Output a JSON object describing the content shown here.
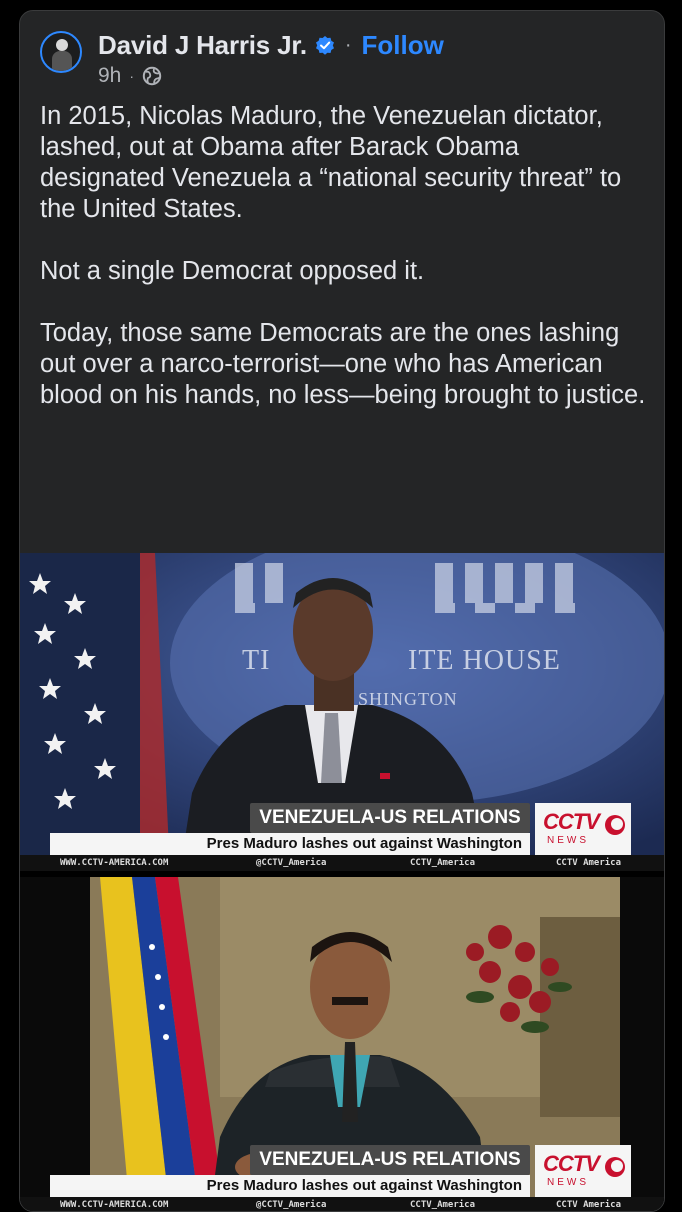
{
  "post": {
    "author": "David J Harris Jr.",
    "follow_label": "Follow",
    "separator": "·",
    "time": "9h",
    "text": [
      "In 2015, Nicolas Maduro, the Venezuelan dictator, lashed, out at Obama after Barack Obama designated Venezuela a “national security threat” to the United States.",
      "Not a single Democrat opposed it.",
      "Today, those same Democrats are the ones lashing out over a narco-terrorist—one who has American blood on his hands, no less—being brought to justice."
    ]
  },
  "media": {
    "frame1": {
      "backdrop_text_1": "TI",
      "backdrop_text_2": "ITE HOUSE",
      "backdrop_text_3": "SHINGTON",
      "lower_third": {
        "title": "VENEZUELA-US RELATIONS",
        "subtitle": "Pres Maduro lashes out against Washington",
        "website": "WWW.CCTV-AMERICA.COM",
        "twitter": "@CCTV_America",
        "facebook": "CCTV_America",
        "youtube": "CCTV America",
        "logo_main": "CCTV",
        "logo_sub": "NEWS"
      }
    },
    "frame2": {
      "lower_third": {
        "title": "VENEZUELA-US RELATIONS",
        "subtitle": "Pres Maduro lashes out against Washington",
        "website": "WWW.CCTV-AMERICA.COM",
        "twitter": "@CCTV_America",
        "facebook": "CCTV_America",
        "youtube": "CCTV America",
        "logo_main": "CCTV",
        "logo_sub": "NEWS"
      }
    }
  },
  "colors": {
    "card_bg": "#242526",
    "text": "#e4e6eb",
    "secondary_text": "#b0b3b8",
    "accent": "#2d88ff",
    "cctv_red": "#c8102e"
  }
}
